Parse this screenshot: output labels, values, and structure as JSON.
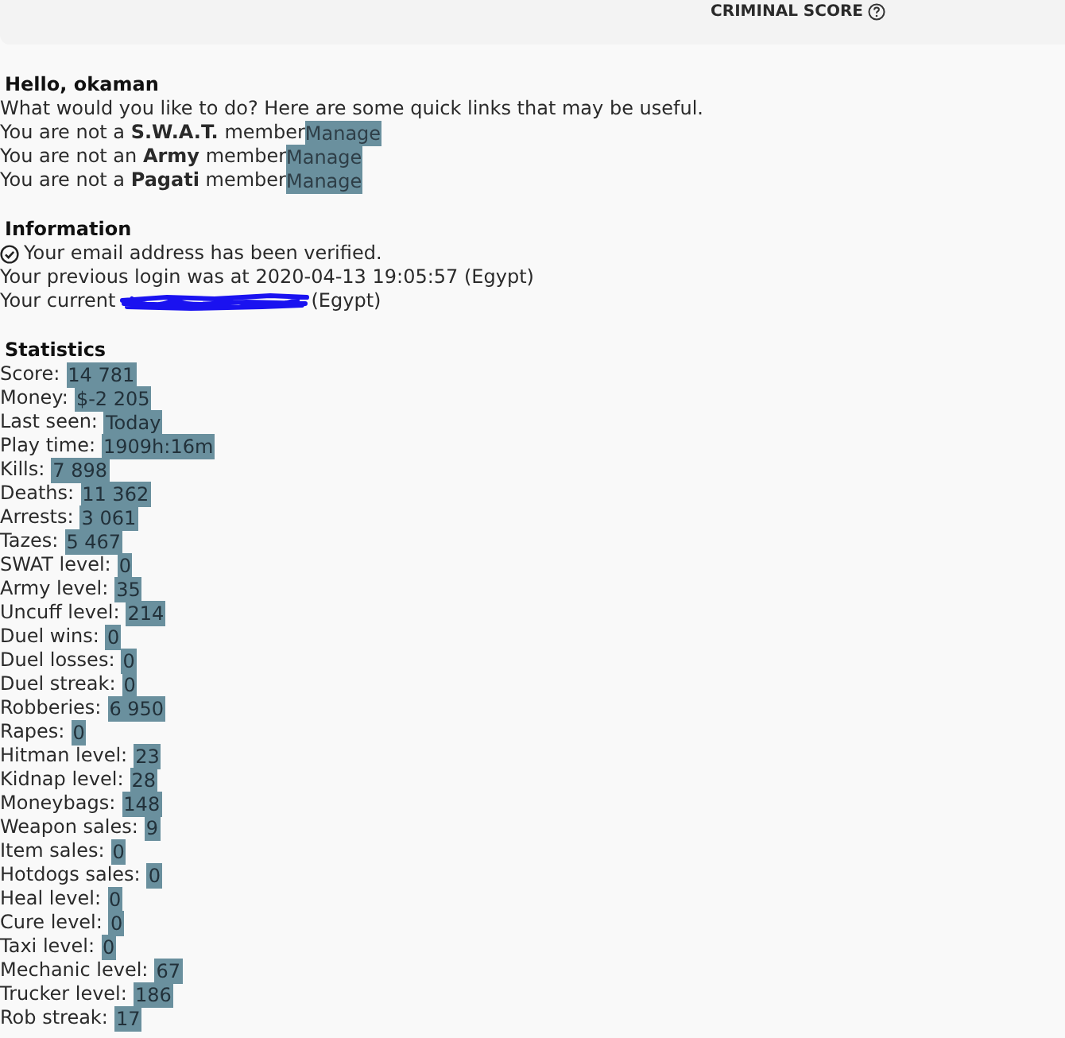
{
  "top_bar": {
    "label": "CRIMINAL SCORE"
  },
  "greeting": {
    "title": "Hello, okaman",
    "intro": "What would you like to do? Here are some quick links that may be useful.",
    "memberships": [
      {
        "text": "You are not a **S.W.A.T.** member",
        "link": "Manage"
      },
      {
        "text": "You are not an **Army** member",
        "link": "Manage"
      },
      {
        "text": "You are not a **Pagati** member",
        "link": "Manage"
      }
    ]
  },
  "information": {
    "title": "Information",
    "email_status": {
      "text": "Your email address has been verified.",
      "verified": true
    },
    "previous_login": "Your previous login was at 2020-04-13 19:05:57 (Egypt)",
    "current_location": {
      "prefix": "Your current",
      "suffix": "(Egypt)",
      "redacted": true
    }
  },
  "statistics": {
    "title": "Statistics",
    "rows": [
      {
        "label": "Score:",
        "value": "14 781"
      },
      {
        "label": "Money:",
        "value": "$-2 205"
      },
      {
        "label": "Last seen:",
        "value": "Today"
      },
      {
        "label": "Play time:",
        "value": "1909h:16m"
      },
      {
        "label": "Kills:",
        "value": "7 898"
      },
      {
        "label": "Deaths:",
        "value": "11 362"
      },
      {
        "label": "Arrests:",
        "value": "3 061"
      },
      {
        "label": "Tazes:",
        "value": "5 467"
      },
      {
        "label": "SWAT level:",
        "value": "0"
      },
      {
        "label": "Army level:",
        "value": "35"
      },
      {
        "label": "Uncuff level:",
        "value": "214"
      },
      {
        "label": "Duel wins:",
        "value": "0"
      },
      {
        "label": "Duel losses:",
        "value": "0"
      },
      {
        "label": "Duel streak:",
        "value": "0"
      },
      {
        "label": "Robberies:",
        "value": "6 950"
      },
      {
        "label": "Rapes:",
        "value": "0"
      },
      {
        "label": "Hitman level:",
        "value": "23"
      },
      {
        "label": "Kidnap level:",
        "value": "28"
      },
      {
        "label": "Moneybags:",
        "value": "148"
      },
      {
        "label": "Weapon sales:",
        "value": "9"
      },
      {
        "label": "Item sales:",
        "value": "0"
      },
      {
        "label": "Hotdogs sales:",
        "value": "0"
      },
      {
        "label": "Heal level:",
        "value": "0"
      },
      {
        "label": "Cure level:",
        "value": "0"
      },
      {
        "label": "Taxi level:",
        "value": "0"
      },
      {
        "label": "Mechanic level:",
        "value": "67"
      },
      {
        "label": "Trucker level:",
        "value": "186"
      },
      {
        "label": "Rob streak:",
        "value": "17"
      }
    ]
  }
}
